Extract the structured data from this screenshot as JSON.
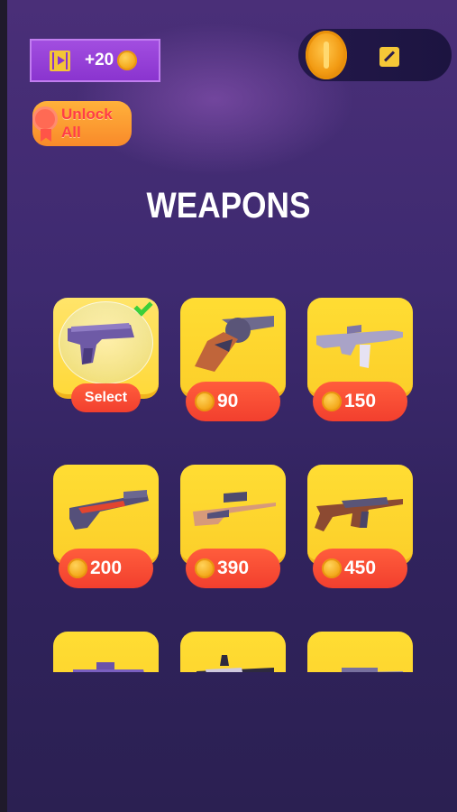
{
  "header": {
    "reward_label": "+20",
    "unlock_all_label": "Unlock All"
  },
  "title": "WEAPONS",
  "weapons": [
    {
      "name": "desert-eagle",
      "state": "selected",
      "action_label": "Select"
    },
    {
      "name": "revolver",
      "price": "90"
    },
    {
      "name": "m16-rifle",
      "price": "150"
    },
    {
      "name": "shotgun",
      "price": "200"
    },
    {
      "name": "sniper-rifle",
      "price": "390"
    },
    {
      "name": "ak47",
      "price": "450"
    },
    {
      "name": "smg",
      "price": ""
    },
    {
      "name": "heavy-rifle",
      "price": ""
    },
    {
      "name": "machine-gun",
      "price": ""
    }
  ],
  "colors": {
    "background": "#3e2a70",
    "card": "#fcd42c",
    "price_pill": "#f5452f",
    "accent_purple": "#9a44dc",
    "coin": "#f4a91c",
    "check": "#3ccf3a"
  }
}
